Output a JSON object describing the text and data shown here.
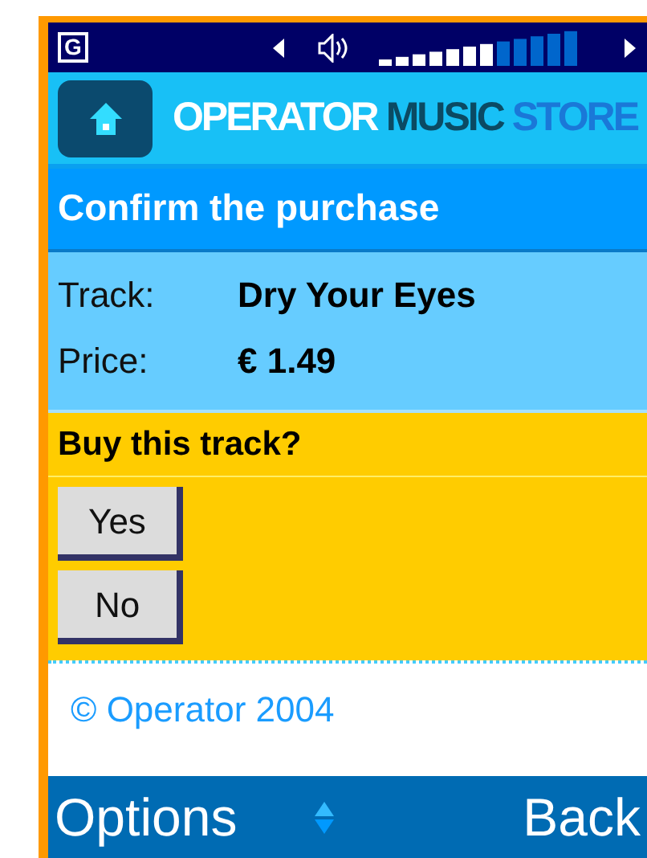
{
  "status_bar": {
    "network": "G",
    "volume": {
      "level": 0.58
    }
  },
  "header": {
    "logo": [
      {
        "text": "OPERATOR",
        "color": "#ffffff"
      },
      {
        "text": "MUSIC",
        "color": "#0b4a63"
      },
      {
        "text": "STORE",
        "color": "#1a78d8"
      }
    ]
  },
  "title": "Confirm the purchase",
  "details": [
    {
      "label": "Track:",
      "value": "Dry Your Eyes"
    },
    {
      "label": "Price:",
      "value": "€ 1.49"
    }
  ],
  "question": "Buy this track?",
  "buttons": [
    "Yes",
    "No"
  ],
  "footer": "© Operator 2004",
  "softkeys": {
    "left": "Options",
    "right": "Back"
  }
}
